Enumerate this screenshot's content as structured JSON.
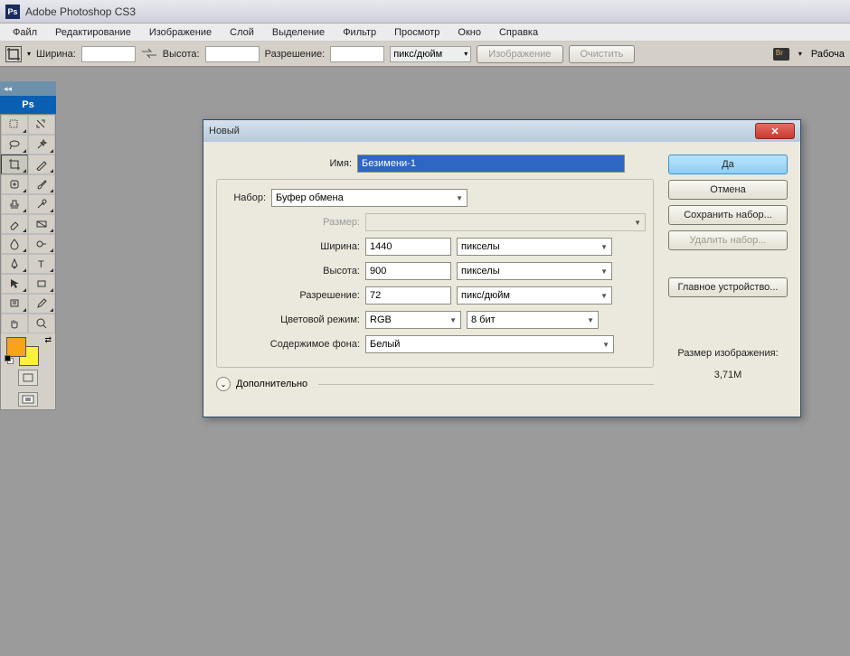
{
  "titlebar": {
    "app_name": "Adobe Photoshop CS3"
  },
  "menu": {
    "items": [
      "Файл",
      "Редактирование",
      "Изображение",
      "Слой",
      "Выделение",
      "Фильтр",
      "Просмотр",
      "Окно",
      "Справка"
    ]
  },
  "optionsbar": {
    "width_label": "Ширина:",
    "width_value": "",
    "height_label": "Высота:",
    "height_value": "",
    "resolution_label": "Разрешение:",
    "resolution_value": "",
    "unit": "пикс/дюйм",
    "button_image": "Изображение",
    "button_clear": "Очистить",
    "workspace_label": "Рабоча"
  },
  "toolbox": {
    "header": "Ps"
  },
  "dialog": {
    "title": "Новый",
    "name_label": "Имя:",
    "name_value": "Безимени-1",
    "preset_label": "Набор:",
    "preset_value": "Буфер обмена",
    "size_label": "Размер:",
    "size_value": "",
    "width_label": "Ширина:",
    "width_value": "1440",
    "width_unit": "пикселы",
    "height_label": "Высота:",
    "height_value": "900",
    "height_unit": "пикселы",
    "resolution_label": "Разрешение:",
    "resolution_value": "72",
    "resolution_unit": "пикс/дюйм",
    "colormode_label": "Цветовой режим:",
    "colormode_value": "RGB",
    "bitdepth_value": "8 бит",
    "bgcontent_label": "Содержимое фона:",
    "bgcontent_value": "Белый",
    "advanced_label": "Дополнительно",
    "buttons": {
      "ok": "Да",
      "cancel": "Отмена",
      "save_preset": "Сохранить набор...",
      "delete_preset": "Удалить набор...",
      "device_central": "Главное устройство..."
    },
    "image_size_label": "Размер изображения:",
    "image_size_value": "3,71M"
  }
}
